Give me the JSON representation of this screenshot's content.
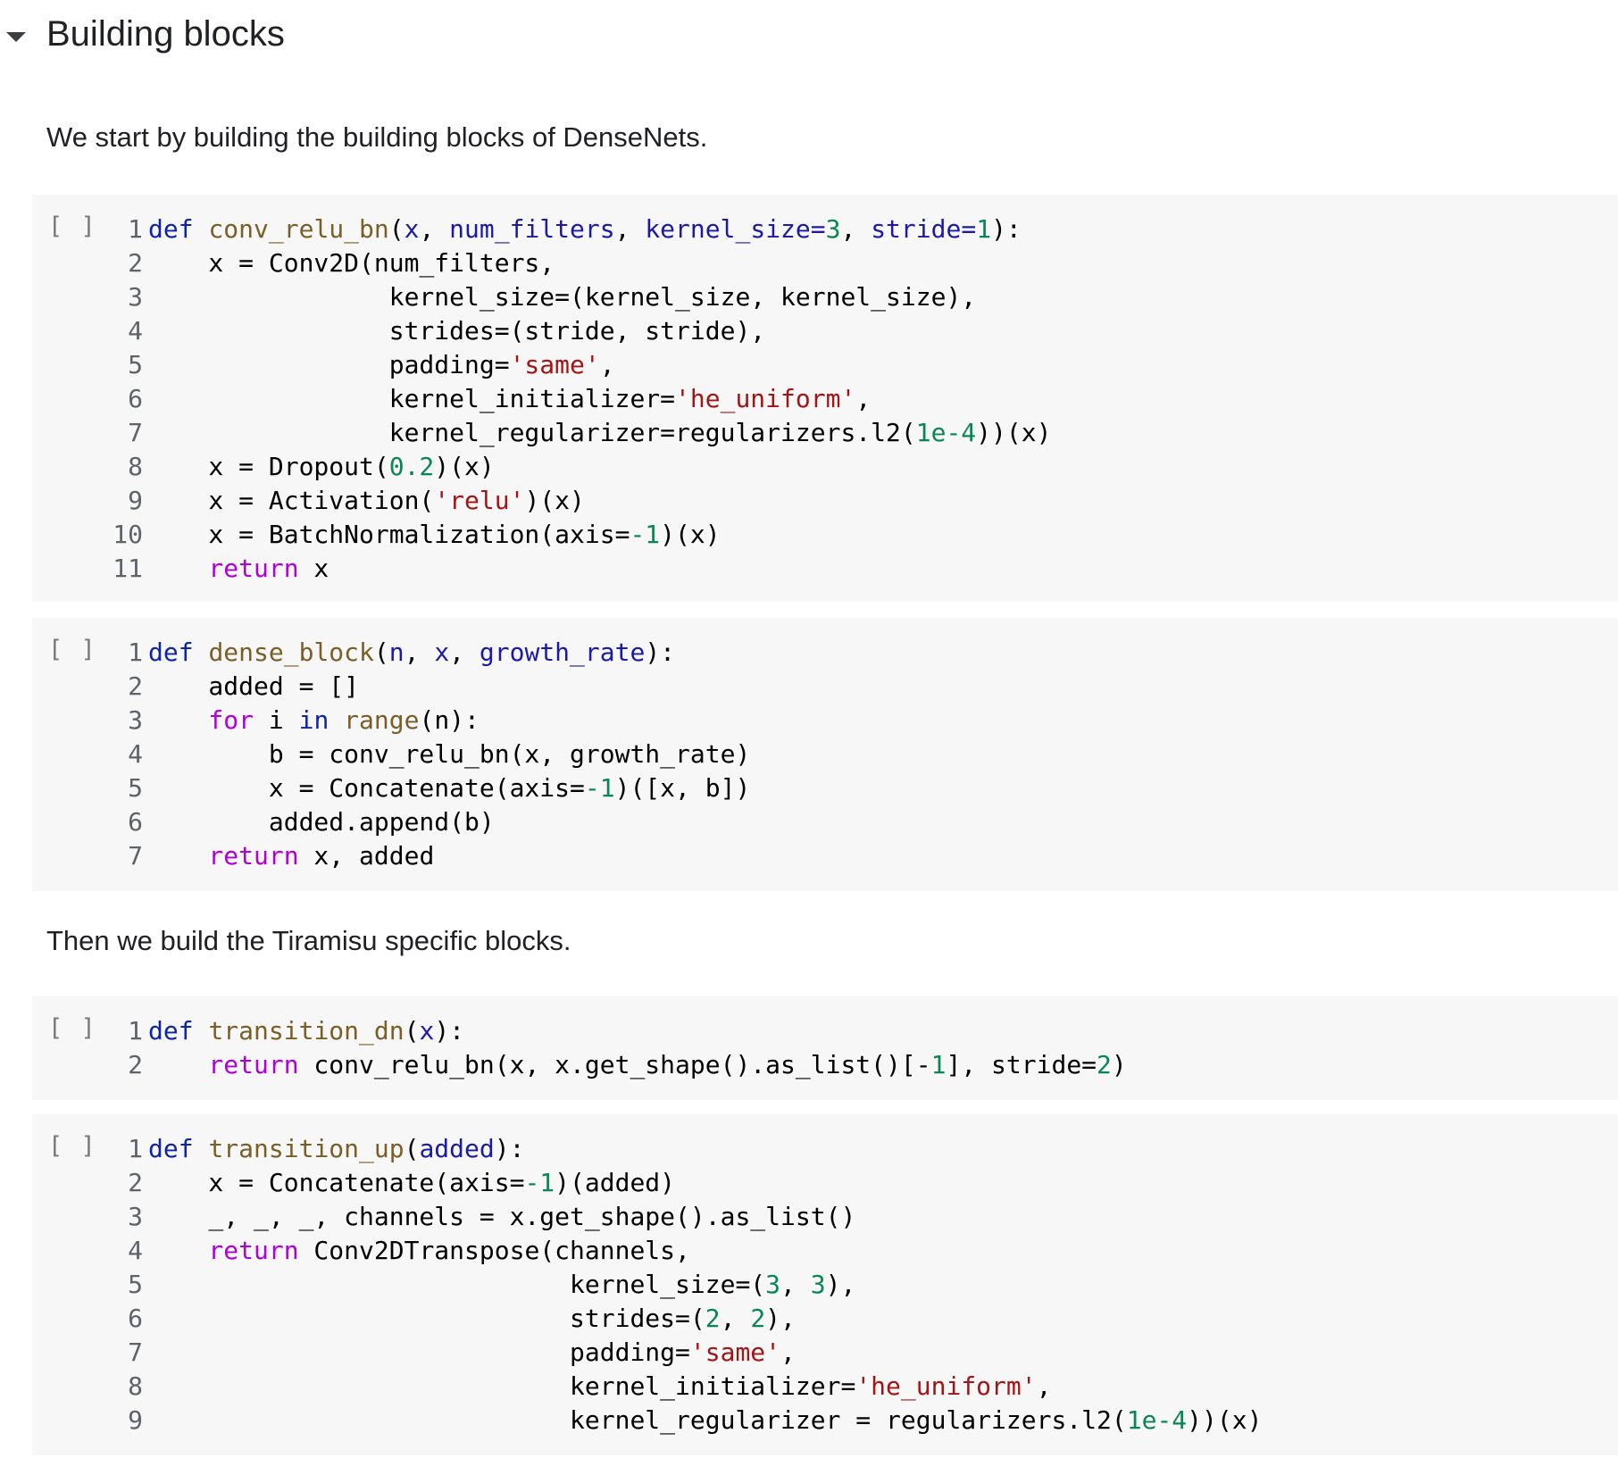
{
  "section": {
    "title": "Building blocks"
  },
  "text_cells": [
    "We start by building the building blocks of DenseNets.",
    "Then we build the Tiramisu specific blocks."
  ],
  "run_label": "[ ]",
  "cells": [
    {
      "lines": [
        [
          [
            "kw",
            "def "
          ],
          [
            "fn",
            "conv_relu_bn"
          ],
          [
            "",
            "("
          ],
          [
            "pm",
            "x"
          ],
          [
            "",
            ", "
          ],
          [
            "pm",
            "num_filters"
          ],
          [
            "",
            ", "
          ],
          [
            "pm",
            "kernel_size"
          ],
          [
            "pm",
            "="
          ],
          [
            "num",
            "3"
          ],
          [
            "",
            ", "
          ],
          [
            "pm",
            "stride"
          ],
          [
            "pm",
            "="
          ],
          [
            "num",
            "1"
          ],
          [
            "",
            "):"
          ]
        ],
        [
          [
            "",
            "    x = Conv2D(num_filters,"
          ]
        ],
        [
          [
            "",
            "                kernel_size=(kernel_size, kernel_size),"
          ]
        ],
        [
          [
            "",
            "                strides=(stride, stride),"
          ]
        ],
        [
          [
            "",
            "                padding="
          ],
          [
            "str",
            "'same'"
          ],
          [
            "",
            ","
          ]
        ],
        [
          [
            "",
            "                kernel_initializer="
          ],
          [
            "str",
            "'he_uniform'"
          ],
          [
            "",
            ","
          ]
        ],
        [
          [
            "",
            "                kernel_regularizer=regularizers.l2("
          ],
          [
            "num",
            "1e-4"
          ],
          [
            "",
            "))(x)"
          ]
        ],
        [
          [
            "",
            "    x = Dropout("
          ],
          [
            "num",
            "0.2"
          ],
          [
            "",
            ")(x)"
          ]
        ],
        [
          [
            "",
            "    x = Activation("
          ],
          [
            "str",
            "'relu'"
          ],
          [
            "",
            ")(x)"
          ]
        ],
        [
          [
            "",
            "    x = BatchNormalization(axis="
          ],
          [
            "num",
            "-1"
          ],
          [
            "",
            ")(x)"
          ]
        ],
        [
          [
            "ctl",
            "    return"
          ],
          [
            "",
            " x"
          ]
        ]
      ]
    },
    {
      "lines": [
        [
          [
            "kw",
            "def "
          ],
          [
            "fn",
            "dense_block"
          ],
          [
            "",
            "("
          ],
          [
            "pm",
            "n"
          ],
          [
            "",
            ", "
          ],
          [
            "pm",
            "x"
          ],
          [
            "",
            ", "
          ],
          [
            "pm",
            "growth_rate"
          ],
          [
            "",
            "):"
          ]
        ],
        [
          [
            "",
            "    added = []"
          ]
        ],
        [
          [
            "ctl",
            "    for"
          ],
          [
            "",
            " i "
          ],
          [
            "kw",
            "in"
          ],
          [
            "",
            " "
          ],
          [
            "fn",
            "range"
          ],
          [
            "",
            "(n):"
          ]
        ],
        [
          [
            "",
            "        b = conv_relu_bn(x, growth_rate)"
          ]
        ],
        [
          [
            "",
            "        x = Concatenate(axis="
          ],
          [
            "num",
            "-1"
          ],
          [
            "",
            ")([x, b])"
          ]
        ],
        [
          [
            "",
            "        added.append(b)"
          ]
        ],
        [
          [
            "ctl",
            "    return"
          ],
          [
            "",
            " x, added"
          ]
        ]
      ]
    },
    {
      "lines": [
        [
          [
            "kw",
            "def "
          ],
          [
            "fn",
            "transition_dn"
          ],
          [
            "",
            "("
          ],
          [
            "pm",
            "x"
          ],
          [
            "",
            "):"
          ]
        ],
        [
          [
            "ctl",
            "    return"
          ],
          [
            "",
            " conv_relu_bn(x, x.get_shape().as_list()[-"
          ],
          [
            "num",
            "1"
          ],
          [
            "",
            "], stride="
          ],
          [
            "num",
            "2"
          ],
          [
            "",
            ")"
          ]
        ]
      ]
    },
    {
      "lines": [
        [
          [
            "kw",
            "def "
          ],
          [
            "fn",
            "transition_up"
          ],
          [
            "",
            "("
          ],
          [
            "pm",
            "added"
          ],
          [
            "",
            "):"
          ]
        ],
        [
          [
            "",
            "    x = Concatenate(axis="
          ],
          [
            "num",
            "-1"
          ],
          [
            "",
            ")(added)"
          ]
        ],
        [
          [
            "",
            "    _, _, _, channels = x.get_shape().as_list()"
          ]
        ],
        [
          [
            "ctl",
            "    return"
          ],
          [
            "",
            " Conv2DTranspose(channels,"
          ]
        ],
        [
          [
            "",
            "                            kernel_size=("
          ],
          [
            "num",
            "3"
          ],
          [
            "",
            ", "
          ],
          [
            "num",
            "3"
          ],
          [
            "",
            "),"
          ]
        ],
        [
          [
            "",
            "                            strides=("
          ],
          [
            "num",
            "2"
          ],
          [
            "",
            ", "
          ],
          [
            "num",
            "2"
          ],
          [
            "",
            "),"
          ]
        ],
        [
          [
            "",
            "                            padding="
          ],
          [
            "str",
            "'same'"
          ],
          [
            "",
            ","
          ]
        ],
        [
          [
            "",
            "                            kernel_initializer="
          ],
          [
            "str",
            "'he_uniform'"
          ],
          [
            "",
            ","
          ]
        ],
        [
          [
            "",
            "                            kernel_regularizer = regularizers.l2("
          ],
          [
            "num",
            "1e-4"
          ],
          [
            "",
            "))(x)"
          ]
        ]
      ]
    }
  ]
}
